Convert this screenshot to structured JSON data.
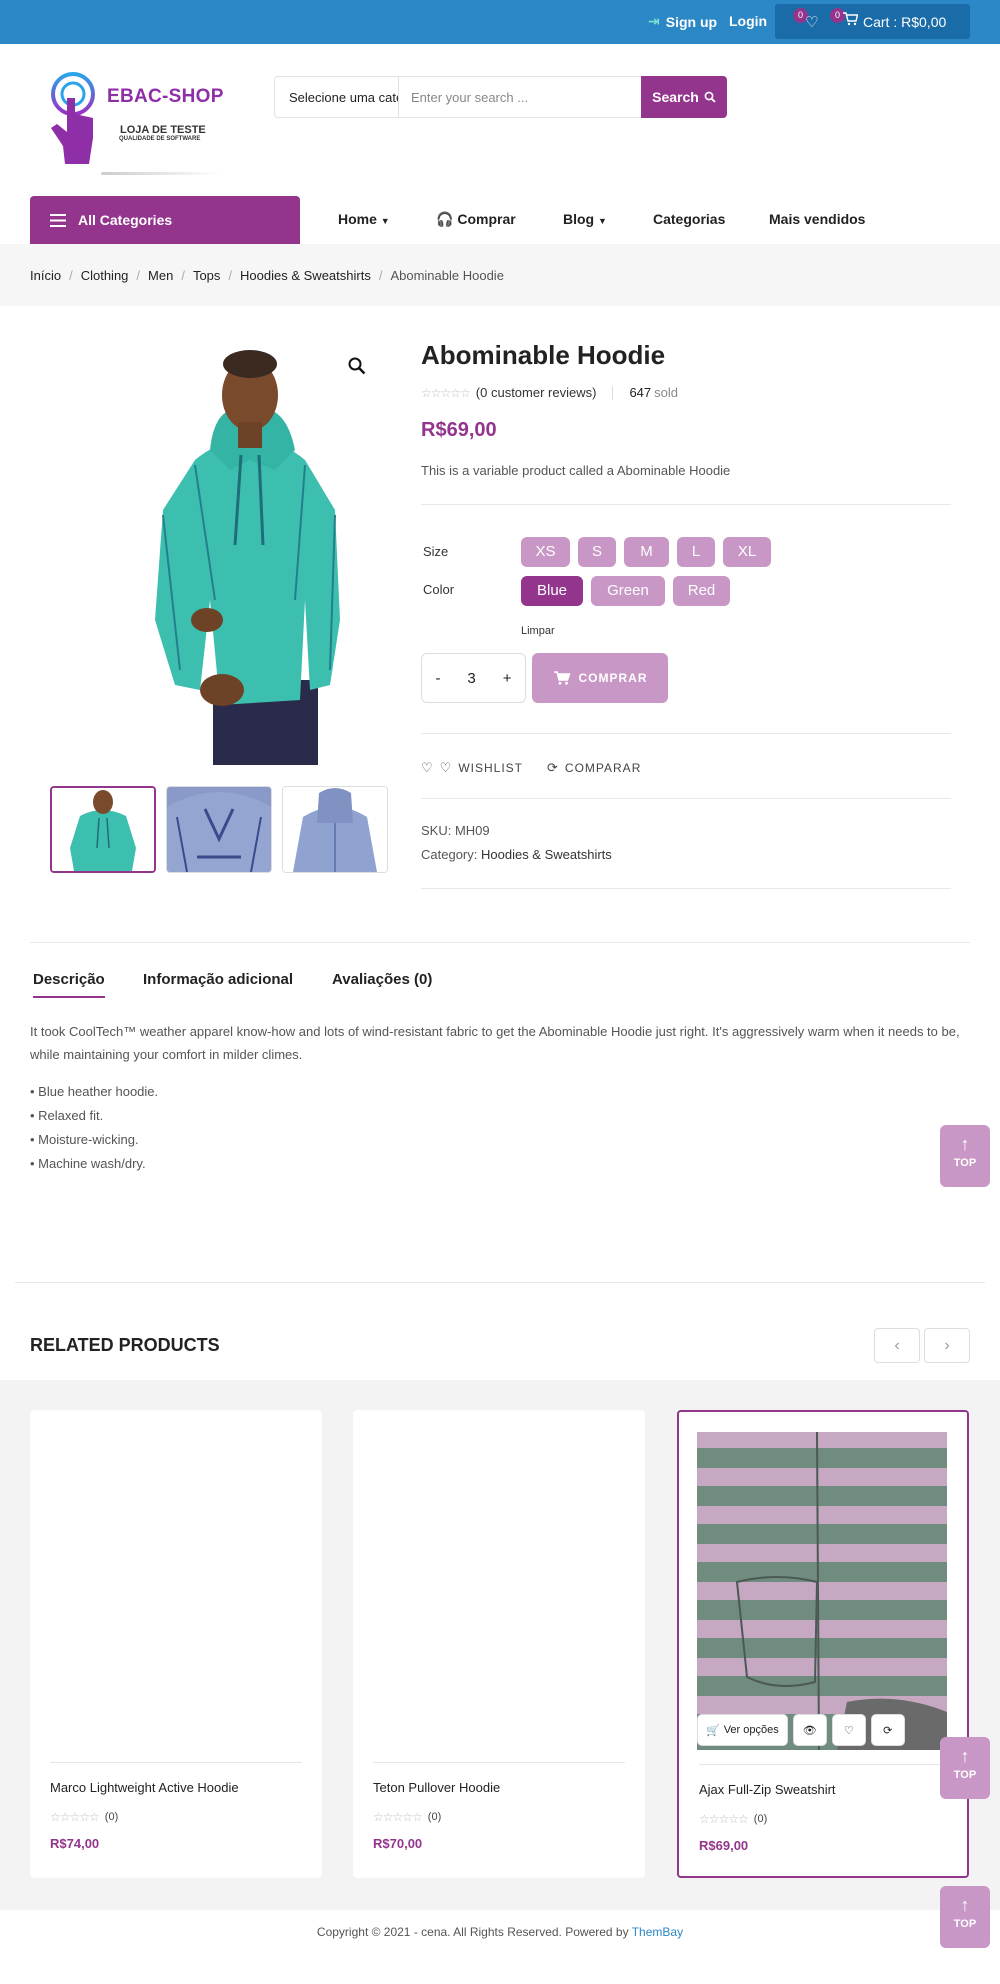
{
  "topbar": {
    "signup": "Sign up",
    "login": "Login",
    "wishlist_count": "0",
    "cart_count": "0",
    "cart_label": "Cart : R$0,00"
  },
  "logo": {
    "title": "EBAC-SHOP",
    "subtitle": "LOJA DE TESTE",
    "tagline": "QUALIDADE DE SOFTWARE"
  },
  "search": {
    "category": "Selecione uma categoria",
    "placeholder": "Enter your search ...",
    "button": "Search"
  },
  "nav": {
    "all_categories": "All Categories",
    "items": [
      "Home",
      "Comprar",
      "Blog",
      "Categorias",
      "Mais vendidos"
    ]
  },
  "breadcrumb": [
    "Início",
    "Clothing",
    "Men",
    "Tops",
    "Hoodies & Sweatshirts",
    "Abominable Hoodie"
  ],
  "product": {
    "title": "Abominable Hoodie",
    "reviews": "(0 customer reviews)",
    "sold_count": "647",
    "sold_label": "sold",
    "price": "R$69,00",
    "short_description": "This is a variable product called a Abominable Hoodie",
    "size_label": "Size",
    "sizes": [
      "XS",
      "S",
      "M",
      "L",
      "XL"
    ],
    "color_label": "Color",
    "colors": [
      "Blue",
      "Green",
      "Red"
    ],
    "selected_color": "Blue",
    "clear": "Limpar",
    "quantity": "3",
    "minus": "-",
    "plus": "+",
    "buy": "COMPRAR",
    "wishlist": "WISHLIST",
    "compare": "COMPARAR",
    "sku_label": "SKU:",
    "sku": "MH09",
    "category_label": "Category:",
    "category": "Hoodies & Sweatshirts"
  },
  "tabs": {
    "items": [
      "Descrição",
      "Informação adicional",
      "Avaliações (0)"
    ],
    "description": "It took CoolTech™ weather apparel know-how and lots of wind-resistant fabric to get the Abominable Hoodie just right. It's aggressively warm when it needs to be, while maintaining your comfort in milder climes.",
    "bullets": [
      "• Blue heather hoodie.",
      "• Relaxed fit.",
      "• Moisture-wicking.",
      "• Machine wash/dry."
    ]
  },
  "top_button": "TOP",
  "related": {
    "title": "RELATED PRODUCTS",
    "products": [
      {
        "name": "Marco Lightweight Active Hoodie",
        "reviews": "(0)",
        "price": "R$74,00"
      },
      {
        "name": "Teton Pullover Hoodie",
        "reviews": "(0)",
        "price": "R$70,00"
      },
      {
        "name": "Ajax Full-Zip Sweatshirt",
        "reviews": "(0)",
        "price": "R$69,00"
      }
    ],
    "view_options": "Ver opções"
  },
  "footer": {
    "text": "Copyright © 2021 - cena. All Rights Reserved. Powered by",
    "link": "ThemBay"
  },
  "colors": {
    "topbar": "#2b87c6",
    "accent": "#93358d",
    "chip": "#c897c5"
  }
}
